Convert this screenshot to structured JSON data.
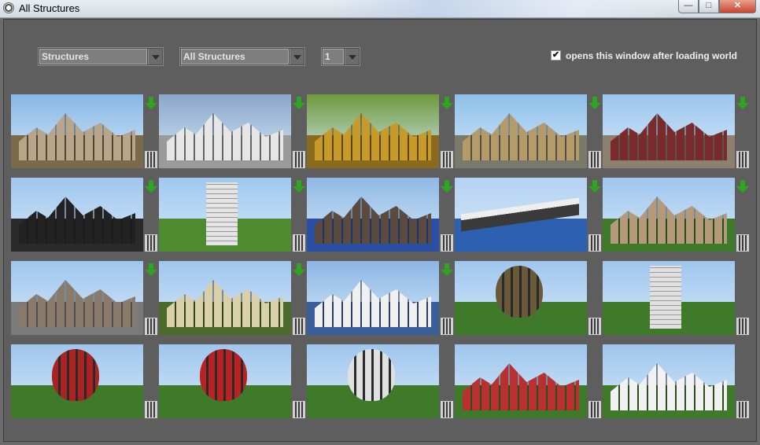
{
  "window": {
    "title": "All Structures"
  },
  "controls": {
    "category": {
      "value": "Structures"
    },
    "filter": {
      "value": "All Structures"
    },
    "page": {
      "value": "1"
    },
    "open_on_load": {
      "checked": true,
      "label": "opens this window after loading world",
      "checkmark": "✔"
    }
  },
  "thumbnails": [
    {
      "theme": "castle-city",
      "sky": "#87b7e6",
      "ground": "#7a6a4a",
      "build": "#b9a68a",
      "download": true
    },
    {
      "theme": "white-city",
      "sky": "#8aa7c9",
      "ground": "#9a9a9a",
      "build": "#e6e6e6",
      "download": true
    },
    {
      "theme": "golden-village",
      "sky": "#6d9a3c",
      "ground": "#8a6a1e",
      "build": "#c79b2a",
      "download": true
    },
    {
      "theme": "palace",
      "sky": "#8ec0ea",
      "ground": "#7a7a6a",
      "build": "#b59a6a",
      "download": true
    },
    {
      "theme": "pagoda-town",
      "sky": "#9cc6ee",
      "ground": "#8e8070",
      "build": "#7a2a2a",
      "download": true
    },
    {
      "theme": "characters",
      "sky": "#9fc6ef",
      "ground": "#2a2a2a",
      "build": "#222222",
      "download": true
    },
    {
      "theme": "hotel-tower",
      "sky": "#9fc8f0",
      "ground": "#4e8a2e",
      "build": "#e4e4e4",
      "download": true
    },
    {
      "theme": "dark-fortress",
      "sky": "#8fb9e6",
      "ground": "#2b4fa5",
      "build": "#5a4a40",
      "download": true
    },
    {
      "theme": "titanic",
      "sky": "#b4d2f2",
      "ground": "#2d60b0",
      "build": "#3a3a3a",
      "download": true
    },
    {
      "theme": "domed-cathedral",
      "sky": "#9fc6ee",
      "ground": "#3e7a2a",
      "build": "#b59a7a",
      "download": true
    },
    {
      "theme": "grand-temple",
      "sky": "#9fc6ee",
      "ground": "#7a7a7a",
      "build": "#8a7a6a",
      "download": true
    },
    {
      "theme": "hill-castle",
      "sky": "#9fc6ee",
      "ground": "#4b6a2b",
      "build": "#d9cfa8",
      "download": true
    },
    {
      "theme": "airship-station",
      "sky": "#8cb6e6",
      "ground": "#3a5e9a",
      "build": "#f0f0f0",
      "download": true
    },
    {
      "theme": "hot-air-balloon-gold",
      "sky": "#9fc6ee",
      "ground": "#3e7a2a",
      "build": "#6a5a3a",
      "download": false
    },
    {
      "theme": "lighthouse",
      "sky": "#9fc6ee",
      "ground": "#3e7a2a",
      "build": "#e0e0e0",
      "download": false
    },
    {
      "theme": "balloon-red-black",
      "sky": "#9fc6ee",
      "ground": "#3e7a2a",
      "build": "#aa2222",
      "download": false
    },
    {
      "theme": "balloon-red-white",
      "sky": "#9fc6ee",
      "ground": "#3e7a2a",
      "build": "#b82222",
      "download": false
    },
    {
      "theme": "balloon-white-red",
      "sky": "#9fc6ee",
      "ground": "#3e7a2a",
      "build": "#e0e0e0",
      "download": false
    },
    {
      "theme": "round-hut",
      "sky": "#9fc6ee",
      "ground": "#3e7a2a",
      "build": "#b83030",
      "download": false
    },
    {
      "theme": "modern-house",
      "sky": "#9fc6ee",
      "ground": "#3e7a2a",
      "build": "#f2f2f2",
      "download": false
    }
  ]
}
